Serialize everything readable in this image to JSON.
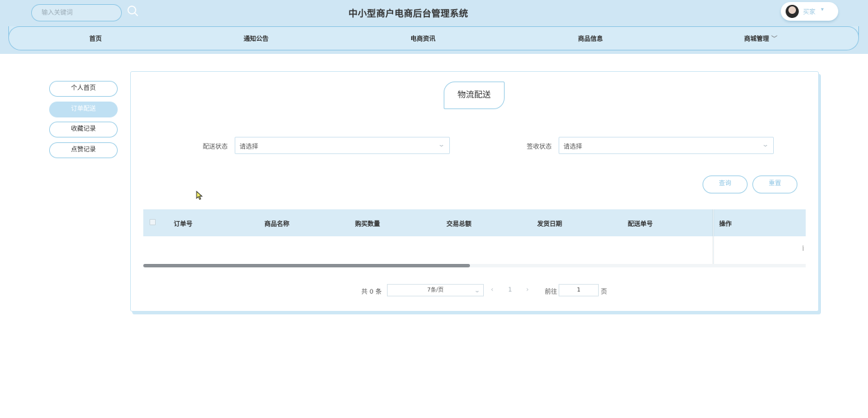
{
  "header": {
    "search_placeholder": "输入关键词",
    "site_title": "中小型商户电商后台管理系统",
    "user_name": "买家",
    "user_caret": "▾",
    "nav": [
      "首页",
      "通知公告",
      "电商资讯",
      "商品信息",
      "商城管理"
    ],
    "nav_dropdown_caret": "﹀"
  },
  "sidebar": {
    "items": [
      "个人首页",
      "订单配送",
      "收藏记录",
      "点赞记录"
    ],
    "active_index": 1
  },
  "main": {
    "title": "物流配送",
    "filters": {
      "delivery_status_label": "配送状态",
      "delivery_status_placeholder": "请选择",
      "sign_status_label": "签收状态",
      "sign_status_placeholder": "请选择"
    },
    "buttons": {
      "query": "查询",
      "reset": "重置"
    },
    "table": {
      "columns": [
        "订单号",
        "商品名称",
        "购买数量",
        "交易总额",
        "发货日期",
        "配送单号",
        "操作"
      ],
      "rows": [],
      "cut_off_text": "Î"
    },
    "pagination": {
      "total_text": "共 0 条",
      "page_size": "7条/页",
      "current_page": "1",
      "goto_label": "前往",
      "goto_value": "1",
      "page_suffix": "页",
      "prev_icon": "‹",
      "next_icon": "›"
    }
  },
  "colors": {
    "header_bg": "#cfe6f4",
    "accent_border": "#9ccfe8",
    "active_side_bg": "#bfe0f3",
    "table_head_bg": "#d8ebf6"
  }
}
